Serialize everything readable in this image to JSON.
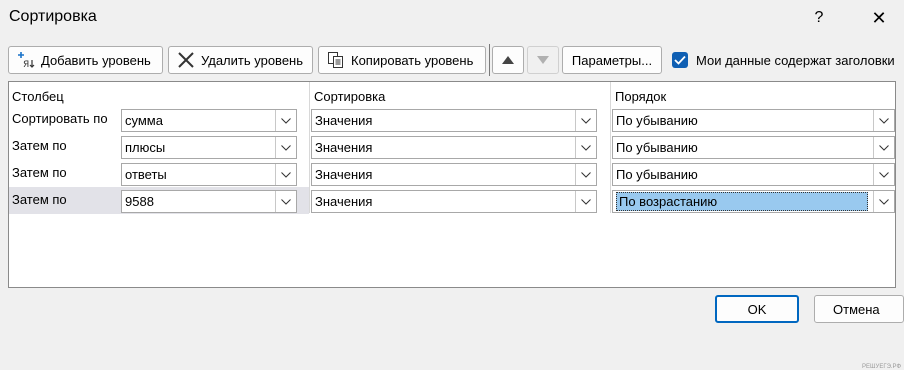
{
  "window": {
    "title": "Сортировка",
    "help": "?",
    "close": "✕"
  },
  "toolbar": {
    "add_label": "Добавить уровень",
    "delete_label": "Удалить уровень",
    "copy_label": "Копировать уровень",
    "params_label": "Параметры...",
    "headers_checkbox_label": "Мои данные содержат заголовки",
    "headers_checked": true
  },
  "grid": {
    "col_headers": {
      "column": "Столбец",
      "sort": "Сортировка",
      "order": "Порядок"
    },
    "rows": [
      {
        "label": "Сортировать по",
        "column": "сумма",
        "sort": "Значения",
        "order": "По убыванию"
      },
      {
        "label": "Затем по",
        "column": "плюсы",
        "sort": "Значения",
        "order": "По убыванию"
      },
      {
        "label": "Затем по",
        "column": "ответы",
        "sort": "Значения",
        "order": "По убыванию"
      },
      {
        "label": "Затем по",
        "column": "9588",
        "sort": "Значения",
        "order": "По возрастанию"
      }
    ],
    "watermark": "РЕШУЕГЭ.РФ"
  },
  "footer": {
    "ok_label": "OK",
    "cancel_label": "Отмена"
  },
  "colors": {
    "accent": "#0067c0",
    "checkbox": "#0f5fb3",
    "selection": "#99c9ef"
  }
}
